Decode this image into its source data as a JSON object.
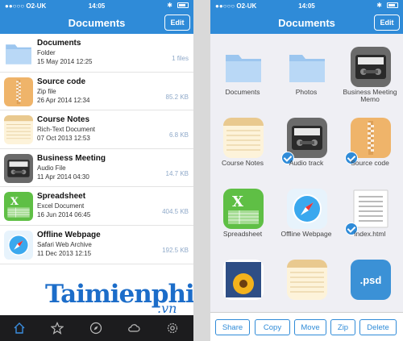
{
  "colors": {
    "accent": "#2f8bd8",
    "tabbar": "#1c1c1e"
  },
  "left": {
    "status": {
      "carrier": "●●○○○ O2-UK",
      "time": "14:05"
    },
    "nav": {
      "title": "Documents",
      "edit": "Edit"
    },
    "items": [
      {
        "name": "Documents",
        "type": "Folder",
        "date": "15 May 2014 12:25",
        "size": "1 files",
        "icon": "folder-icon"
      },
      {
        "name": "Source code",
        "type": "Zip file",
        "date": "26 Apr 2014 12:34",
        "size": "85.2 KB",
        "icon": "zip-icon"
      },
      {
        "name": "Course Notes",
        "type": "Rich-Text Document",
        "date": "07 Oct 2013 12:53",
        "size": "6.8 KB",
        "icon": "notes-icon"
      },
      {
        "name": "Business Meeting",
        "type": "Audio File",
        "date": "11 Apr 2014 04:30",
        "size": "14.7 KB",
        "icon": "audio-icon"
      },
      {
        "name": "Spreadsheet",
        "type": "Excel Document",
        "date": "16 Jun 2014 06:45",
        "size": "404.5 KB",
        "icon": "excel-icon"
      },
      {
        "name": "Offline Webpage",
        "type": "Safari Web Archive",
        "date": "11 Dec 2013 12:15",
        "size": "192.5 KB",
        "icon": "safari-icon"
      }
    ],
    "tabs": [
      "home-icon",
      "star-icon",
      "compass-icon",
      "cloud-icon",
      "settings-icon"
    ],
    "watermark": {
      "main": "Taimienphi",
      "sub": ".vn"
    }
  },
  "right": {
    "status": {
      "carrier": "●●○○○ O2-UK",
      "time": "14:05"
    },
    "nav": {
      "title": "Documents",
      "edit": "Edit"
    },
    "grid": [
      {
        "label": "Documents",
        "icon": "folder-icon",
        "checked": false
      },
      {
        "label": "Photos",
        "icon": "folder-icon",
        "checked": false
      },
      {
        "label": "Business Meeting Memo",
        "icon": "audio-icon",
        "checked": false
      },
      {
        "label": "Course Notes",
        "icon": "notes-icon",
        "checked": false
      },
      {
        "label": "Audio track",
        "icon": "audio-icon",
        "checked": true
      },
      {
        "label": "Source code",
        "icon": "zip-icon",
        "checked": true
      },
      {
        "label": "Spreadsheet",
        "icon": "excel-icon",
        "checked": false
      },
      {
        "label": "Offline Webpage",
        "icon": "safari-icon",
        "checked": false
      },
      {
        "label": "index.html",
        "icon": "html-icon",
        "checked": true
      },
      {
        "label": "",
        "icon": "image-icon",
        "checked": false
      },
      {
        "label": "",
        "icon": "notes-icon",
        "checked": false
      },
      {
        "label": "",
        "icon": "psd-icon",
        "checked": false,
        "text": ".psd"
      }
    ],
    "actions": [
      "Share",
      "Copy",
      "Move",
      "Zip",
      "Delete"
    ]
  }
}
